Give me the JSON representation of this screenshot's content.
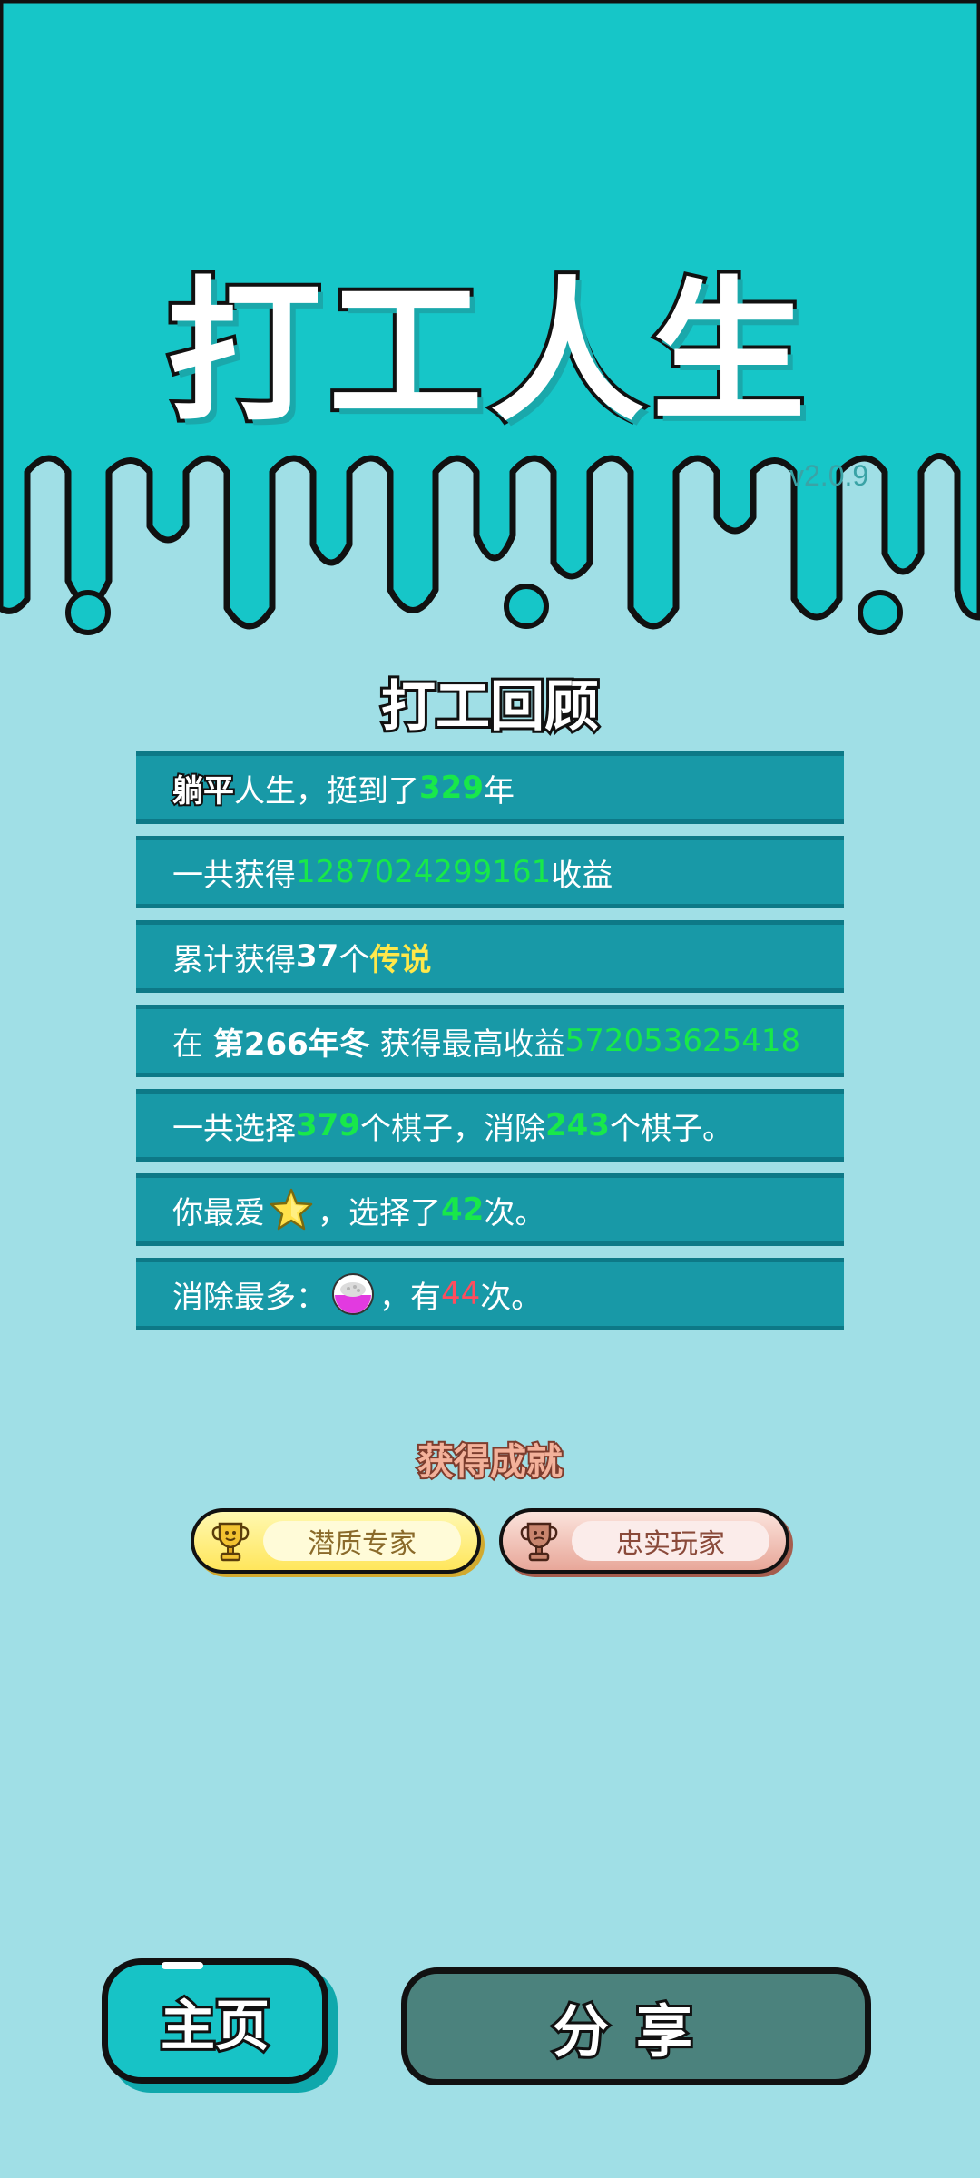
{
  "app": {
    "title": "打工人生",
    "version": "v2.0.9"
  },
  "colors": {
    "header_bg": "#16c6c8",
    "page_bg": "#a0dfe6",
    "row_bg": "#1899a7",
    "highlight_green": "#18e84a",
    "highlight_yellow": "#ffe84a",
    "highlight_red": "#ff4d5e"
  },
  "review": {
    "title": "打工回顾",
    "rows": [
      {
        "prefix": "躺平",
        "t1": "人生，挺到了",
        "years": "329",
        "t2": "年"
      },
      {
        "t1": "一共获得",
        "value": "1287024299161",
        "t2": "收益"
      },
      {
        "t1": "累计获得",
        "count": "37",
        "t2": "个",
        "rarity": "传说"
      },
      {
        "t1": "在 ",
        "season": "第266年冬",
        "t2": " 获得最高收益",
        "value": "572053625418"
      },
      {
        "t1": "一共选择",
        "selected": "379",
        "t2": "个棋子，消除",
        "removed": "243",
        "t3": "个棋子。"
      },
      {
        "t1": "你最爱",
        "icon": "star-icon",
        "t2": "，选择了",
        "count": "42",
        "t3": "次。"
      },
      {
        "t1": "消除最多：",
        "icon": "rice-bowl-icon",
        "t2": "，有",
        "count": "44",
        "t3": "次。"
      }
    ]
  },
  "achievements": {
    "title": "获得成就",
    "items": [
      {
        "label": "潜质专家",
        "icon": "gold-trophy-icon",
        "tier": "gold"
      },
      {
        "label": "忠实玩家",
        "icon": "bronze-trophy-icon",
        "tier": "bronze"
      }
    ]
  },
  "buttons": {
    "home": "主页",
    "share": "分享"
  }
}
